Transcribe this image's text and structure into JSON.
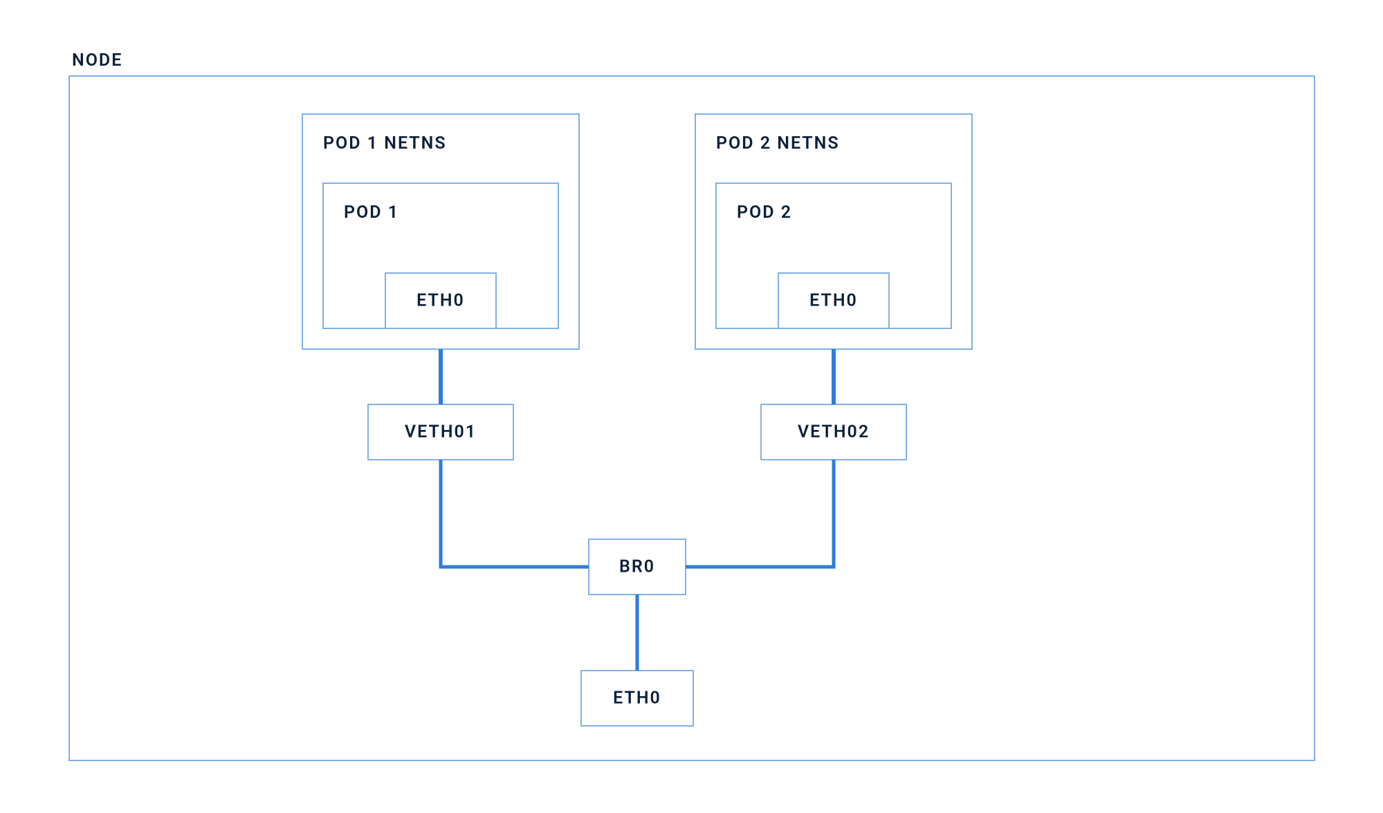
{
  "diagram": {
    "node_label": "NODE",
    "pods": [
      {
        "netns_label": "POD 1 NETNS",
        "pod_label": "POD 1",
        "eth_label": "ETH0",
        "veth_label": "VETH01"
      },
      {
        "netns_label": "POD 2 NETNS",
        "pod_label": "POD 2",
        "eth_label": "ETH0",
        "veth_label": "VETH02"
      }
    ],
    "bridge_label": "BR0",
    "node_eth_label": "ETH0"
  },
  "colors": {
    "border_light": "#7fb0ea",
    "line_strong": "#2a7de1",
    "text": "#0b1f3a"
  }
}
